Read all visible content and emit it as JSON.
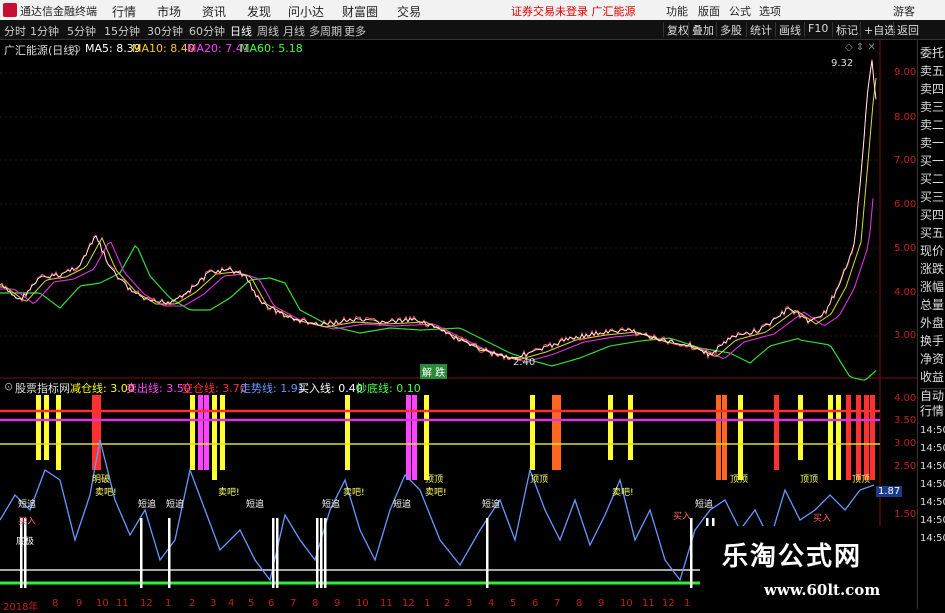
{
  "titlebar": {
    "app_name": "通达信金融终端",
    "menus": [
      "行情",
      "市场",
      "资讯",
      "发现",
      "问小达",
      "财富圈",
      "交易"
    ],
    "warning": "证券交易未登录  广汇能源",
    "right_buttons": [
      "功能",
      "版面",
      "公式",
      "选项"
    ],
    "user": "游客"
  },
  "periodbar": {
    "periods": [
      "分时",
      "1分钟",
      "5分钟",
      "15分钟",
      "30分钟",
      "60分钟",
      "日线",
      "周线",
      "月线",
      "多周期",
      "更多"
    ],
    "active": "日线",
    "tools": [
      "复权",
      "叠加",
      "多股",
      "统计",
      "画线",
      "F10",
      "标记",
      "+自选",
      "返回"
    ]
  },
  "main_chart": {
    "title": "广汇能源(日线)",
    "ma": [
      {
        "label": "MA5: 8.39",
        "color": "#ffffff"
      },
      {
        "label": "MA10: 8.40",
        "color": "#ffcc00"
      },
      {
        "label": "MA20: 7.41",
        "color": "#ff44ff"
      },
      {
        "label": "MA60: 5.18",
        "color": "#44ff44"
      }
    ],
    "price_axis": [
      "9.00",
      "8.00",
      "7.00",
      "6.00",
      "5.00",
      "4.00",
      "3.00"
    ],
    "high_label": "9.32",
    "low_label": "2.40",
    "badge": "解 跌"
  },
  "indicator": {
    "title": "股票指标网",
    "lines": [
      {
        "label": "减仓线: 3.00",
        "color": "#ffff00"
      },
      {
        "label": "卖出线: 3.50",
        "color": "#ff44ff"
      },
      {
        "label": "空仓线: 3.70",
        "color": "#ff3030"
      },
      {
        "label": "走势线: 1.91",
        "color": "#6699ff"
      },
      {
        "label": "买入线: 0.40",
        "color": "#ffffff"
      },
      {
        "label": "抄底线: 0.10",
        "color": "#44ff44"
      }
    ],
    "axis": [
      "4.00",
      "3.50",
      "3.00",
      "2.50",
      "2.00",
      "1.50",
      "1.00"
    ],
    "current": "1.87",
    "tags": {
      "zhuizhang": "短追",
      "mai": "卖吧!",
      "dingding": "顶顶",
      "mairu": "买入",
      "diji": "底极",
      "mingpo": "明破"
    }
  },
  "x_axis": {
    "year": "2018年",
    "months": [
      "8",
      "9",
      "10",
      "11",
      "12",
      "1",
      "2",
      "3",
      "4",
      "5",
      "6",
      "7",
      "8",
      "9",
      "10",
      "11",
      "12",
      "1",
      "2",
      "3",
      "4",
      "5",
      "6",
      "7",
      "8",
      "9",
      "10",
      "11",
      "12",
      "1",
      "2",
      "3"
    ]
  },
  "side_panel": {
    "items": [
      "委托",
      "卖五",
      "卖四",
      "卖三",
      "卖二",
      "卖一",
      "买一",
      "买二",
      "买三",
      "买四",
      "买五",
      "现价",
      "涨跌",
      "涨幅",
      "总量",
      "外盘",
      "换手",
      "净资",
      "收益"
    ],
    "lower_items": [
      "自动",
      "行情"
    ],
    "times": [
      "14:50",
      "14:50",
      "14:50",
      "14:50",
      "14:50",
      "14:50",
      "14:50"
    ]
  },
  "watermark": {
    "title": "乐淘公式网",
    "url": "www.60lt.com"
  }
}
